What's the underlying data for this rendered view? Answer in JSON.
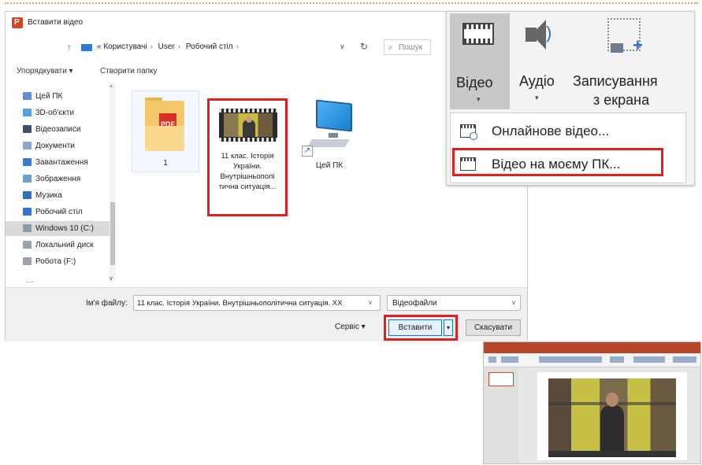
{
  "dialog": {
    "title": "Вставити відео",
    "breadcrumb": [
      "Користувачі",
      "User",
      "Робочий стіл"
    ],
    "breadcrumb_prefix": "«",
    "search_placeholder": "Пошук",
    "toolbar": {
      "organize": "Упорядкувати ▾",
      "new_folder": "Створити папку"
    },
    "nav_items": [
      {
        "label": "Цей ПК",
        "color": "#5b8fd6",
        "selected": false
      },
      {
        "label": "3D-об'єкти",
        "color": "#4fa3e0",
        "selected": false
      },
      {
        "label": "Відеозаписи",
        "color": "#3d4f66",
        "selected": false
      },
      {
        "label": "Документи",
        "color": "#8aa8cf",
        "selected": false
      },
      {
        "label": "Завантаження",
        "color": "#2f7fd6",
        "selected": false
      },
      {
        "label": "Зображення",
        "color": "#6a9fd0",
        "selected": false
      },
      {
        "label": "Музика",
        "color": "#2f6fbf",
        "selected": false
      },
      {
        "label": "Робочий стіл",
        "color": "#2b79d7",
        "selected": false
      },
      {
        "label": "Windows 10 (C:)",
        "color": "#8a9aa8",
        "selected": true
      },
      {
        "label": "Локальний диск",
        "color": "#9aa3ab",
        "selected": false
      },
      {
        "label": "Робота (F:)",
        "color": "#9aa3ab",
        "selected": false
      }
    ],
    "nav_more": "…",
    "files": {
      "folder": {
        "name": "1",
        "badge": "PDF"
      },
      "video": {
        "name": "11 клас. Історія України. Внутрішньополі тична ситуація..."
      },
      "pc": {
        "name": "Цей ПК"
      }
    },
    "filename_label": "Ім'я файлу:",
    "filename_value": "11 клас. Історія України. Внутрішньополітична ситуація. XX",
    "filetype_value": "Відеофайли",
    "tools_label": "Сервіс",
    "insert_label": "Вставити",
    "cancel_label": "Скасувати"
  },
  "ribbon": {
    "video_label": "Відео",
    "audio_label": "Аудіо",
    "screen_label_line1": "Записування",
    "screen_label_line2": "з екрана",
    "menu": [
      {
        "label": "Онлайнове відео...",
        "icon": "online-video-icon"
      },
      {
        "label": "Відео на моєму ПК...",
        "icon": "pc-video-icon"
      }
    ]
  },
  "colors": {
    "highlight": "#e02020",
    "ppt_accent": "#b7472a",
    "selection_blue": "#0078d7"
  }
}
